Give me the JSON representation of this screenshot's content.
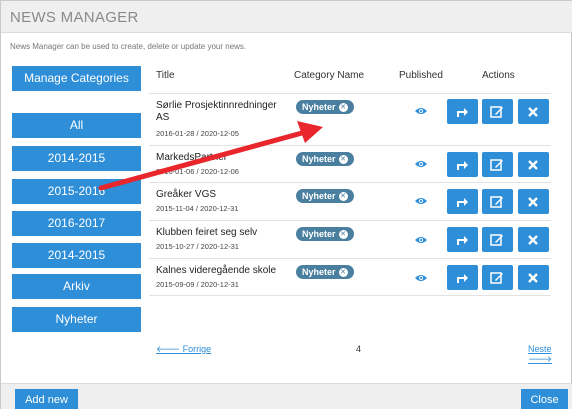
{
  "window": {
    "title": "NEWS MANAGER"
  },
  "description": "News Manager can be used to create, delete or update your news.",
  "sidebar": {
    "manage_label": "Manage Categories",
    "items": [
      {
        "label": "All"
      },
      {
        "label": "2014-2015"
      },
      {
        "label": "2015-2016"
      },
      {
        "label": "2016-2017"
      },
      {
        "label": "2014-2015"
      },
      {
        "label": "Arkiv"
      },
      {
        "label": "Nyheter"
      }
    ]
  },
  "table": {
    "headers": {
      "title": "Title",
      "category": "Category Name",
      "published": "Published",
      "actions": "Actions"
    },
    "rows": [
      {
        "title": "Sørlie Prosjektinnredninger AS",
        "dates": "2016-01-28 / 2020-12-05",
        "category": "Nyheter"
      },
      {
        "title": "MarkedsPartner",
        "dates": "2016-01-06 / 2020-12-06",
        "category": "Nyheter"
      },
      {
        "title": "Greåker VGS",
        "dates": "2015-11-04 / 2020-12-31",
        "category": "Nyheter"
      },
      {
        "title": "Klubben feiret seg selv",
        "dates": "2015-10-27 / 2020-12-31",
        "category": "Nyheter"
      },
      {
        "title": "Kalnes videregående skole",
        "dates": "2015-09-09 / 2020-12-31",
        "category": "Nyheter"
      }
    ]
  },
  "pagination": {
    "prev": "Forrige",
    "page": "4",
    "next": "Neste"
  },
  "footer": {
    "add_label": "Add new",
    "close_label": "Close"
  },
  "colors": {
    "accent": "#2e8ed8",
    "badge": "#4a7fa0",
    "arrow": "#e8262b",
    "eye": "#2e8ed8"
  }
}
